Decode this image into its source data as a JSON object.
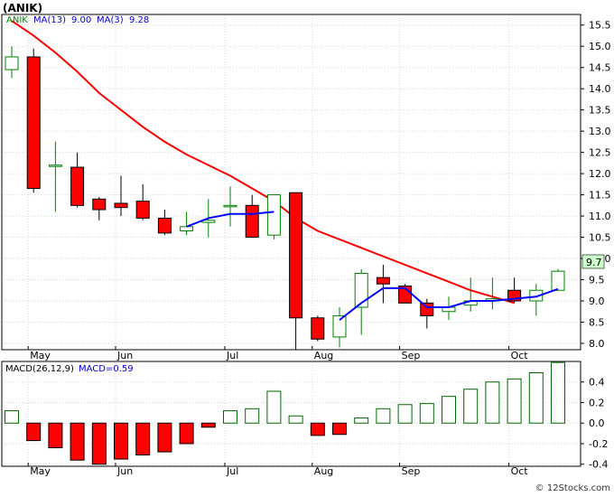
{
  "header": {
    "title": "(ANIK)"
  },
  "watermark": "© 12Stocks.com",
  "colors": {
    "up": "#008000",
    "down": "#ff0000",
    "ma13": "#ff0000",
    "ma3": "#0000ff",
    "macd_bar": "#006600",
    "panel_bg": "#ffffff",
    "axis": "#000000"
  },
  "chart_data": [
    {
      "type": "candlestick",
      "title": "",
      "legend": {
        "symbol": "ANIK",
        "ma13_label": "MA(13)",
        "ma13_value": "9.00",
        "ma3_label": "MA(3)",
        "ma3_value": "9.28"
      },
      "last_price": "9.7",
      "x_labels": [
        {
          "index": 1,
          "text": "May"
        },
        {
          "index": 5,
          "text": "Jun"
        },
        {
          "index": 10,
          "text": "Jul"
        },
        {
          "index": 14,
          "text": "Aug"
        },
        {
          "index": 18,
          "text": "Sep"
        },
        {
          "index": 23,
          "text": "Oct"
        }
      ],
      "y_ticks": [
        "8.0",
        "8.5",
        "9.0",
        "9.5",
        "10.0",
        "10.5",
        "11.0",
        "11.5",
        "12.0",
        "12.5",
        "13.0",
        "13.5",
        "14.0",
        "14.5",
        "15.0",
        "15.5"
      ],
      "ylim": [
        7.85,
        15.75
      ],
      "weeks": [
        {
          "o": 14.45,
          "h": 15.0,
          "l": 14.25,
          "c": 14.75
        },
        {
          "o": 14.75,
          "h": 14.95,
          "l": 11.55,
          "c": 11.65
        },
        {
          "o": 12.2,
          "h": 12.75,
          "l": 11.1,
          "c": 12.2
        },
        {
          "o": 12.15,
          "h": 12.5,
          "l": 11.2,
          "c": 11.25
        },
        {
          "o": 11.4,
          "h": 11.45,
          "l": 10.9,
          "c": 11.15
        },
        {
          "o": 11.3,
          "h": 11.95,
          "l": 11.0,
          "c": 11.2
        },
        {
          "o": 11.35,
          "h": 11.75,
          "l": 10.9,
          "c": 10.95
        },
        {
          "o": 10.95,
          "h": 11.15,
          "l": 10.55,
          "c": 10.6
        },
        {
          "o": 10.65,
          "h": 11.1,
          "l": 10.55,
          "c": 10.75
        },
        {
          "o": 10.85,
          "h": 11.4,
          "l": 10.5,
          "c": 10.9
        },
        {
          "o": 11.25,
          "h": 11.7,
          "l": 10.75,
          "c": 11.25
        },
        {
          "o": 11.25,
          "h": 11.5,
          "l": 10.5,
          "c": 10.5
        },
        {
          "o": 10.55,
          "h": 11.5,
          "l": 10.45,
          "c": 11.5
        },
        {
          "o": 11.55,
          "h": 11.55,
          "l": 7.85,
          "c": 8.6
        },
        {
          "o": 8.6,
          "h": 8.65,
          "l": 8.05,
          "c": 8.1
        },
        {
          "o": 8.15,
          "h": 8.85,
          "l": 7.9,
          "c": 8.65
        },
        {
          "o": 8.85,
          "h": 9.75,
          "l": 8.2,
          "c": 9.65
        },
        {
          "o": 9.55,
          "h": 9.85,
          "l": 8.95,
          "c": 9.4
        },
        {
          "o": 9.35,
          "h": 9.4,
          "l": 8.95,
          "c": 8.95
        },
        {
          "o": 8.95,
          "h": 9.05,
          "l": 8.35,
          "c": 8.65
        },
        {
          "o": 8.75,
          "h": 9.1,
          "l": 8.55,
          "c": 8.85
        },
        {
          "o": 8.9,
          "h": 9.55,
          "l": 8.75,
          "c": 9.0
        },
        {
          "o": 9.0,
          "h": 9.55,
          "l": 8.8,
          "c": 9.05
        },
        {
          "o": 9.25,
          "h": 9.55,
          "l": 8.95,
          "c": 9.0
        },
        {
          "o": 9.0,
          "h": 9.4,
          "l": 8.65,
          "c": 9.25
        },
        {
          "o": 9.25,
          "h": 9.75,
          "l": 9.25,
          "c": 9.7
        }
      ],
      "ma13": [
        15.6,
        15.25,
        14.85,
        14.4,
        13.9,
        13.5,
        13.1,
        12.75,
        12.45,
        12.2,
        11.95,
        11.65,
        11.35,
        10.95,
        10.65,
        10.45,
        10.25,
        10.05,
        9.85,
        9.65,
        9.45,
        9.25,
        9.1,
        8.95
      ],
      "ma3": [
        null,
        null,
        null,
        null,
        null,
        null,
        null,
        null,
        10.75,
        10.95,
        11.05,
        11.05,
        11.1,
        null,
        null,
        8.55,
        8.95,
        9.3,
        9.3,
        8.85,
        8.85,
        9.0,
        9.0,
        9.05,
        9.1,
        9.28
      ]
    },
    {
      "type": "bar",
      "title": "",
      "legend": {
        "label": "MACD(26,12,9)",
        "value_label": "MACD=0.59"
      },
      "y_ticks": [
        "-0.4",
        "-0.2",
        "0.0",
        "0.2",
        "0.4"
      ],
      "ylim": [
        -0.42,
        0.6
      ],
      "values": [
        0.12,
        -0.17,
        -0.24,
        -0.36,
        -0.4,
        -0.35,
        -0.31,
        -0.28,
        -0.2,
        -0.04,
        0.12,
        0.14,
        0.31,
        0.07,
        -0.12,
        -0.11,
        0.05,
        0.14,
        0.18,
        0.19,
        0.26,
        0.33,
        0.4,
        0.43,
        0.49,
        0.59
      ]
    }
  ]
}
